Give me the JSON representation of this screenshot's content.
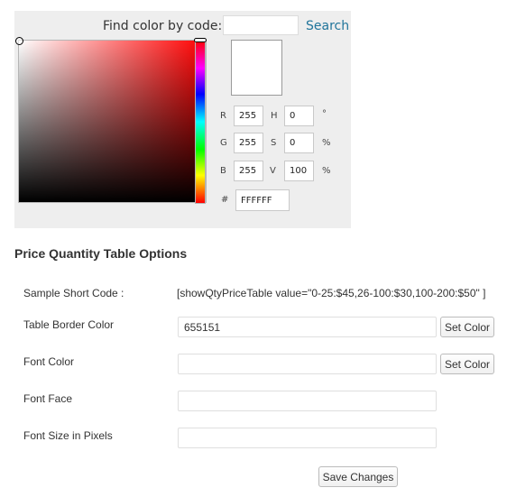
{
  "picker": {
    "find_label": "Find color by code:",
    "find_value": "",
    "search_label": "Search",
    "swatch_color": "#FFFFFF",
    "channels": {
      "r": {
        "label": "R",
        "value": "255"
      },
      "g": {
        "label": "G",
        "value": "255"
      },
      "b": {
        "label": "B",
        "value": "255"
      },
      "h": {
        "label": "H",
        "value": "0",
        "unit": "°"
      },
      "s": {
        "label": "S",
        "value": "0",
        "unit": "%"
      },
      "v": {
        "label": "V",
        "value": "100",
        "unit": "%"
      }
    },
    "hex": {
      "label": "#",
      "value": "FFFFFF"
    }
  },
  "options": {
    "title": "Price Quantity Table Options",
    "short_code": {
      "label": "Sample Short Code :",
      "value": "[showQtyPriceTable value=\"0-25:$45,26-100:$30,100-200:$50\" ]"
    },
    "border_color": {
      "label": "Table Border Color",
      "value": "655151",
      "button": "Set Color"
    },
    "font_color": {
      "label": "Font Color",
      "value": "",
      "button": "Set Color"
    },
    "font_face": {
      "label": "Font Face",
      "value": ""
    },
    "font_size": {
      "label": "Font Size in Pixels",
      "value": ""
    },
    "save_label": "Save Changes"
  }
}
